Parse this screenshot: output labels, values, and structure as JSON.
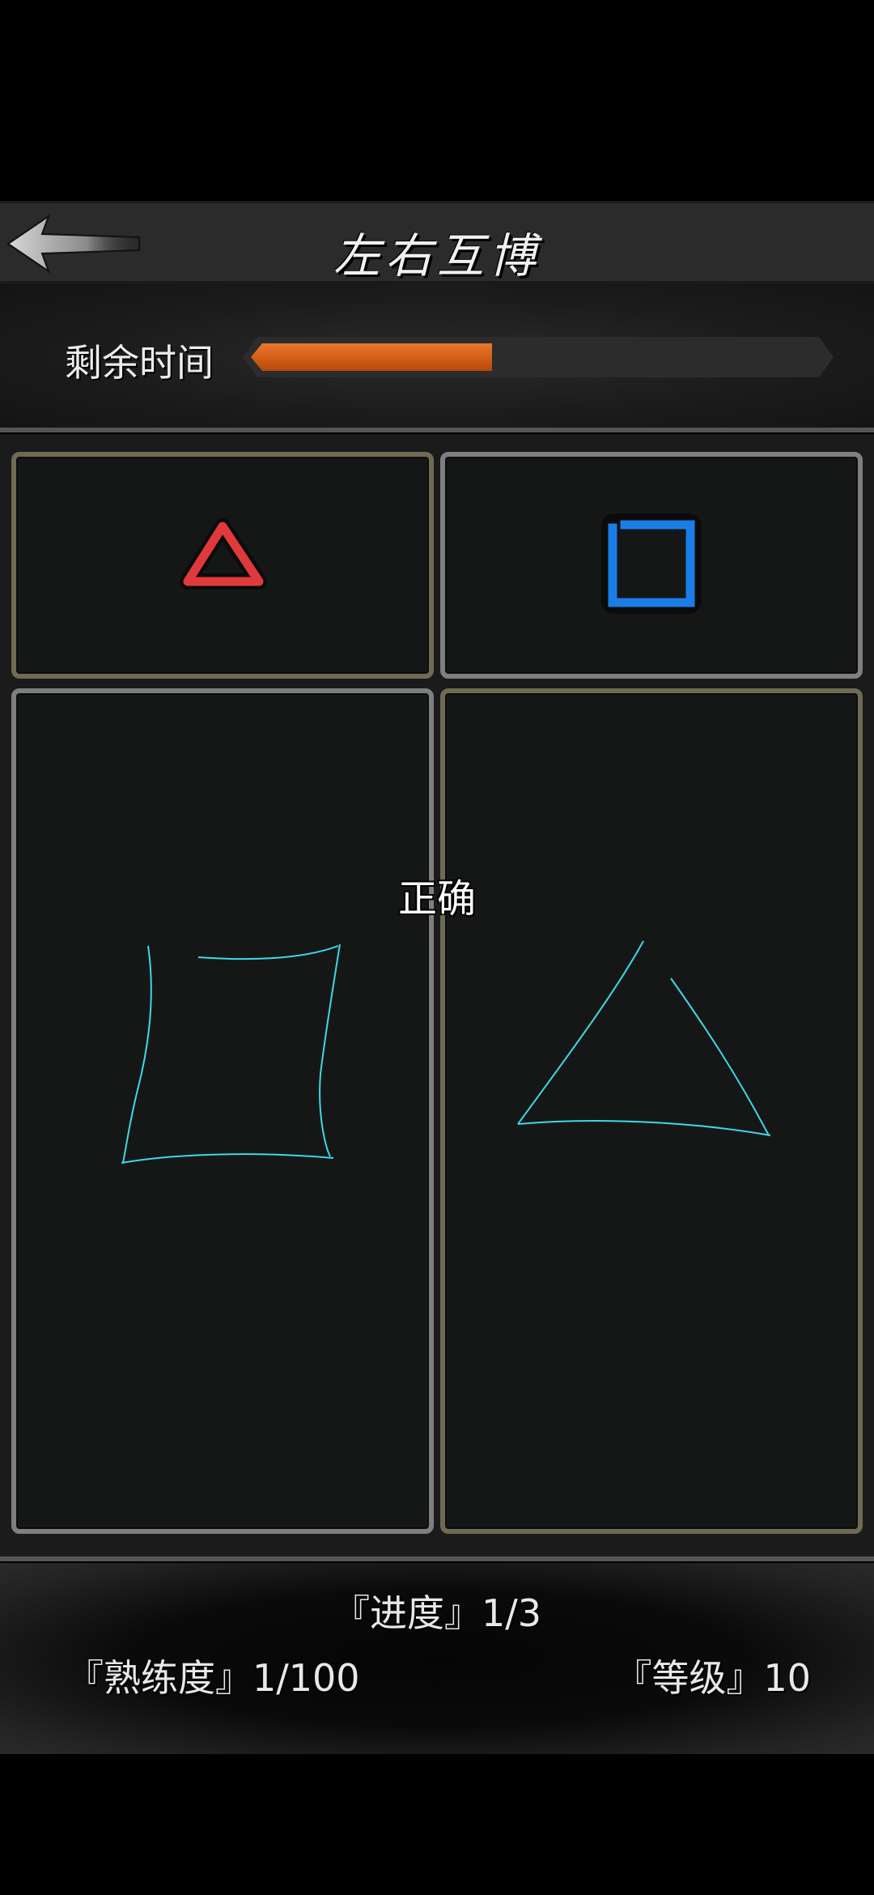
{
  "header": {
    "title": "左右互博",
    "back_icon": "arrow-left-icon"
  },
  "timer": {
    "label": "剩余时间",
    "remaining_fraction": 0.42,
    "fill_color": "#d9601a"
  },
  "targets": {
    "left": {
      "shape": "triangle-icon",
      "color": "#e0393c"
    },
    "right": {
      "shape": "square-icon",
      "color": "#1a7de6"
    }
  },
  "feedback": {
    "text": "正确"
  },
  "drawing": {
    "stroke_color": "#3fd8e6"
  },
  "footer": {
    "progress": "『进度』1/3",
    "proficiency": "『熟练度』1/100",
    "level": "『等级』10"
  }
}
